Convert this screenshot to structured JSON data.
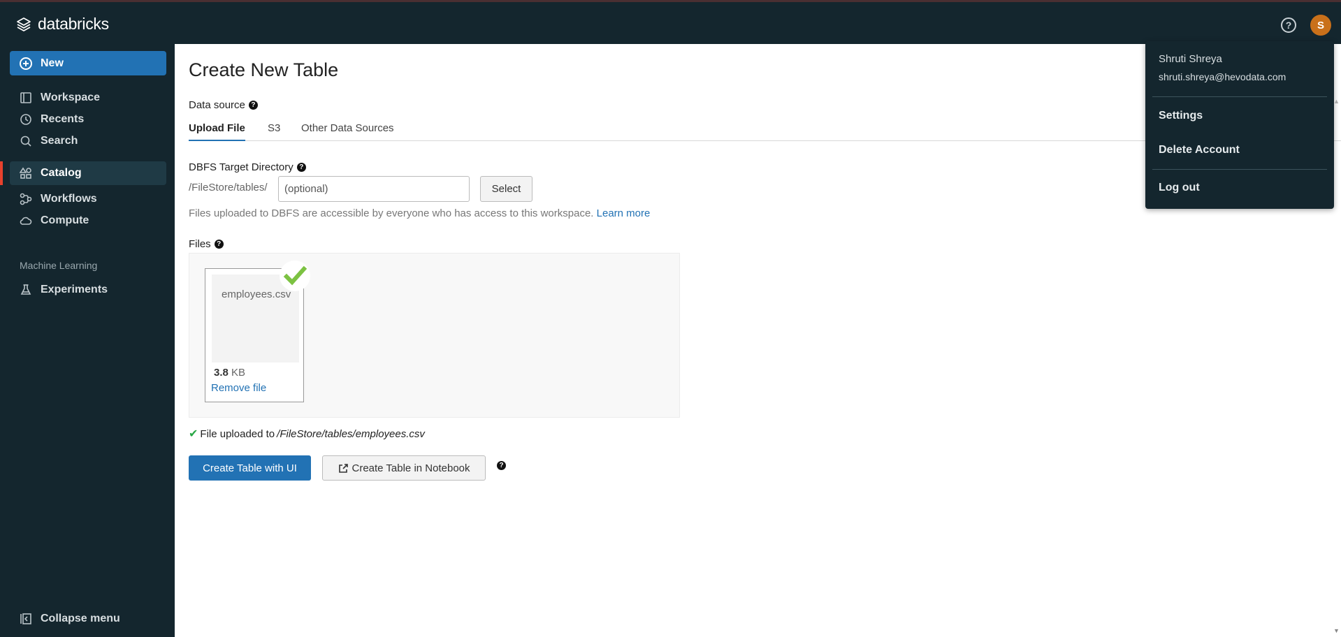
{
  "app": {
    "logo_text": "databricks"
  },
  "header": {
    "help_icon": "?",
    "avatar_initial": "S"
  },
  "sidebar": {
    "new_label": "New",
    "items": [
      {
        "label": "Workspace",
        "icon": "workspace-icon"
      },
      {
        "label": "Recents",
        "icon": "clock-icon"
      },
      {
        "label": "Search",
        "icon": "search-icon"
      },
      {
        "label": "Catalog",
        "icon": "catalog-icon",
        "active": true
      },
      {
        "label": "Workflows",
        "icon": "workflows-icon"
      },
      {
        "label": "Compute",
        "icon": "cloud-icon"
      }
    ],
    "section_ml": "Machine Learning",
    "ml_items": [
      {
        "label": "Experiments",
        "icon": "flask-icon"
      }
    ],
    "collapse_label": "Collapse menu"
  },
  "main": {
    "title": "Create New Table",
    "data_source_label": "Data source",
    "tabs": [
      {
        "label": "Upload File",
        "active": true
      },
      {
        "label": "S3"
      },
      {
        "label": "Other Data Sources"
      }
    ],
    "dbfs_label": "DBFS Target Directory",
    "path_prefix": "/FileStore/tables/",
    "dir_placeholder": "(optional)",
    "select_label": "Select",
    "info_text": "Files uploaded to DBFS are accessible by everyone who has access to this workspace.",
    "learn_more": "Learn more",
    "files_label": "Files",
    "file": {
      "name": "employees.csv",
      "size_value": "3.8",
      "size_unit": "KB",
      "remove_label": "Remove file"
    },
    "uploaded_prefix": "File uploaded to",
    "uploaded_path": "/FileStore/tables/employees.csv",
    "create_ui_label": "Create Table with UI",
    "create_notebook_label": "Create Table in Notebook"
  },
  "user_menu": {
    "name": "Shruti Shreya",
    "email": "shruti.shreya@hevodata.com",
    "items": [
      "Settings",
      "Delete Account",
      "Log out"
    ]
  },
  "colors": {
    "sidebar_bg": "#14262e",
    "accent": "#2272b4",
    "active_marker": "#e8412d",
    "avatar_bg": "#c9701a",
    "success": "#28a745"
  }
}
